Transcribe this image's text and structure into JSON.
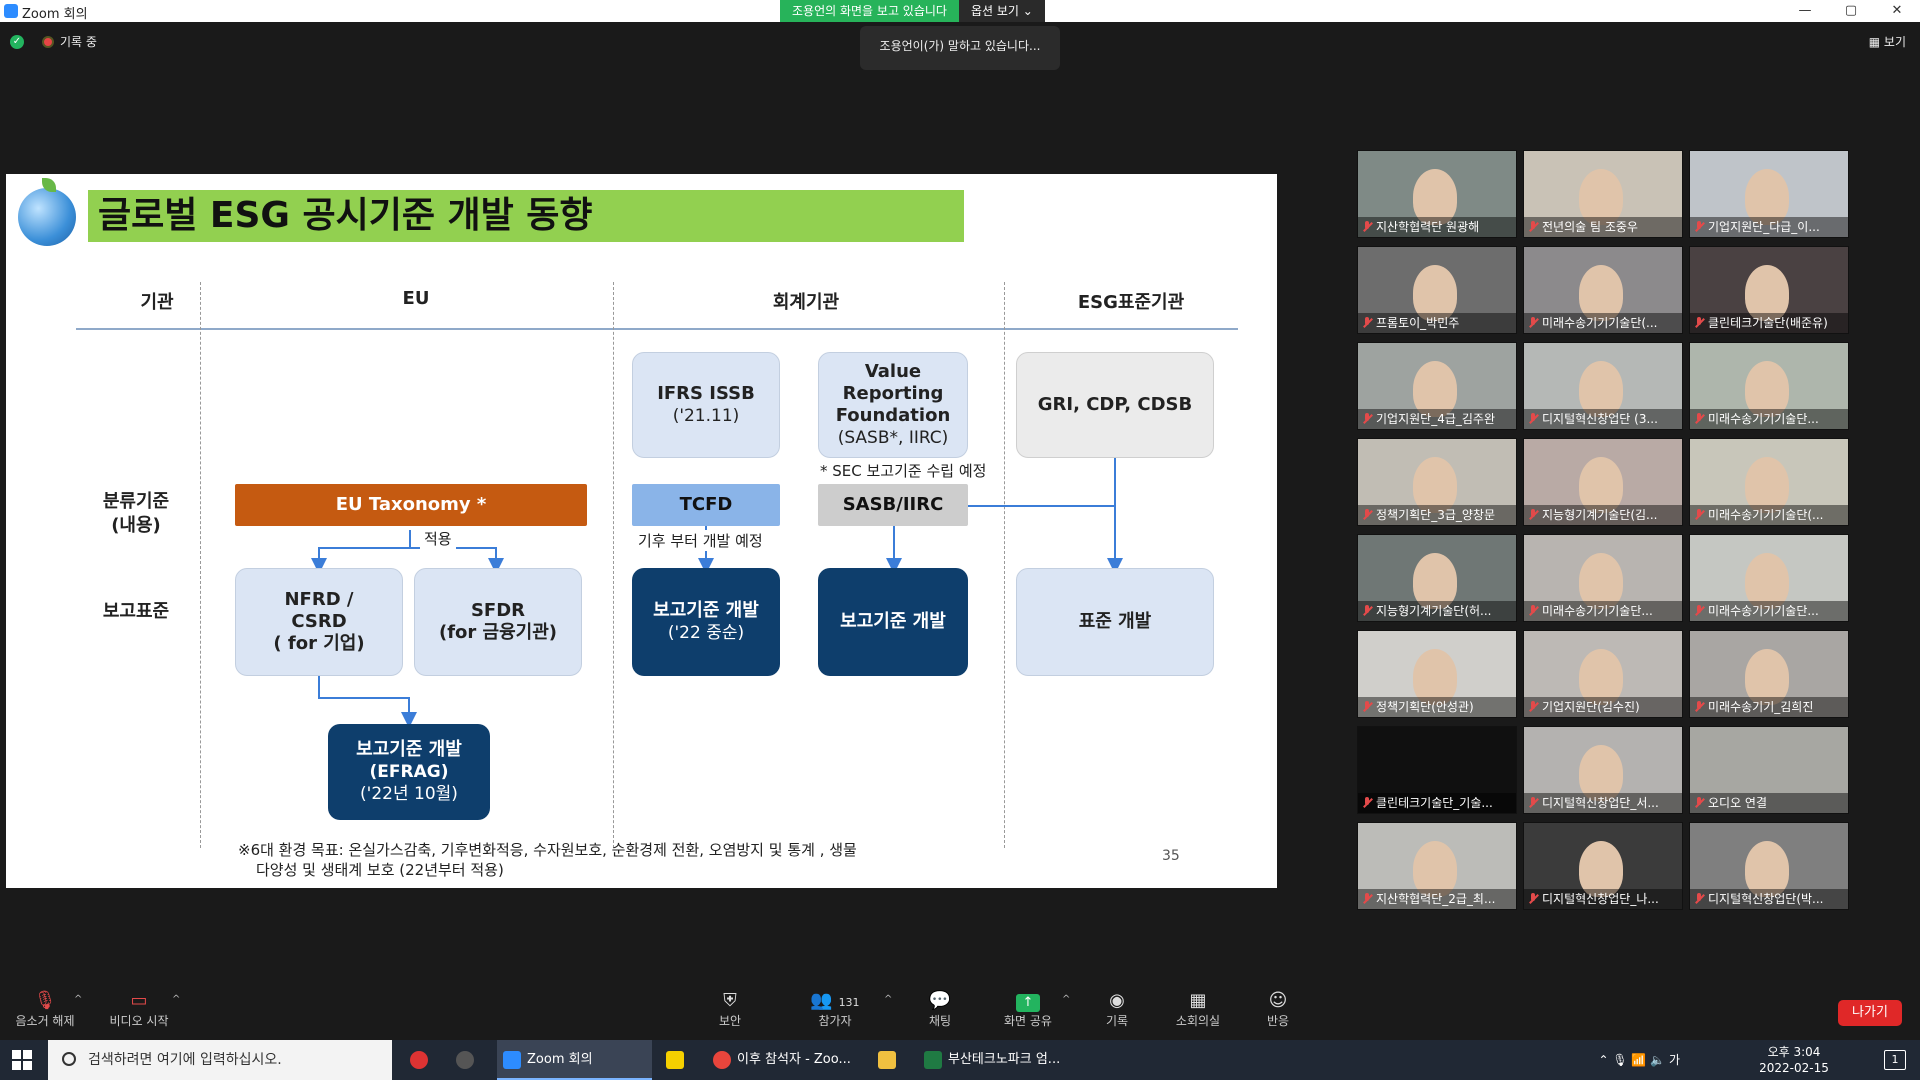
{
  "window": {
    "title": "Zoom 회의",
    "minimize": "—",
    "maximize": "▢",
    "close": "✕"
  },
  "share_banner": {
    "status": "조용언의 화면을 보고 있습니다",
    "options": "옵션 보기 ⌄"
  },
  "top": {
    "recording": "기록 중",
    "speaking": "조용언이(가) 말하고 있습니다...",
    "view": "보기"
  },
  "slide": {
    "title": "글로벌 ESG 공시기준 개발 동향",
    "columns": [
      "기관",
      "EU",
      "회계기관",
      "ESG표준기관"
    ],
    "rows": {
      "classification": "분류기준\n(내용)",
      "reporting": "보고표준"
    },
    "boxes": {
      "ifrs": {
        "title": "IFRS ISSB",
        "sub": "('21.11)"
      },
      "vrf": {
        "title": "Value\nReporting\nFoundation",
        "sub": "(SASB*, IIRC)"
      },
      "gri": "GRI, CDP, CDSB",
      "sec_note": "* SEC 보고기준 수립 예정",
      "taxonomy": "EU Taxonomy *",
      "tcfd": "TCFD",
      "sasb": "SASB/IIRC",
      "applied": "적용",
      "climate_note": "기후 부터 개발 예정",
      "nfrd": "NFRD /\nCSRD\n( for 기업)",
      "sfdr": "SFDR\n(for 금융기관)",
      "dev_mid": {
        "title": "보고기준 개발",
        "sub": "('22 중순)"
      },
      "dev": "보고기준 개발",
      "std": "표준 개발",
      "efrag": {
        "title": "보고기준 개발",
        "mid": "(EFRAG)",
        "sub": "('22년 10월)"
      }
    },
    "footnote1": "※6대 환경 목표: 온실가스감축, 기후변화적응, 수자원보호, 순환경제 전환, 오염방지 및 통계 , 생물",
    "footnote2": "다양성 및 생태계 보호 (22년부터 적용)",
    "page": "35"
  },
  "participants": [
    "지산학협력단 원광해",
    "전년의술 팀 조중우",
    "기업지원단_다급_이...",
    "프롬토이_박민주",
    "미래수송기기기술단(...",
    "클린테크기술단(배준유)",
    "기업지원단_4급_김주완",
    "디지털혁신창업단 (3...",
    "미래수송기기기술단...",
    "정책기획단_3급_양창문",
    "지능형기계기술단(김...",
    "미래수송기기기술단(...",
    "지능형기계기술단(허...",
    "미래수송기기기술단...",
    "미래수송기기기술단...",
    "정책기획단(안성관)",
    "기업지원단(김수진)",
    "미래수송기기_김희진",
    "클린테크기술단_기술...",
    "디지털혁신창업단_서...",
    "오디오 연결",
    "지산학협력단_2급_최...",
    "디지털혁신창업단_나...",
    "디지털혁신창업단(박..."
  ],
  "toolbar": {
    "unmute": "음소거 해제",
    "video": "비디오 시작",
    "security": "보안",
    "participants": "참가자",
    "participant_count": "131",
    "chat": "채팅",
    "share": "화면 공유",
    "record": "기록",
    "breakout": "소회의실",
    "reactions": "반응",
    "leave": "나가기"
  },
  "taskbar": {
    "search_placeholder": "검색하려면 여기에 입력하십시오.",
    "zoom": "Zoom 회의",
    "chrome": "이후 참석자 - Zoo...",
    "excel": "부산테크노파크 엄...",
    "time": "오후 3:04",
    "date": "2022-02-15",
    "ime": "가",
    "notifications": "1"
  }
}
